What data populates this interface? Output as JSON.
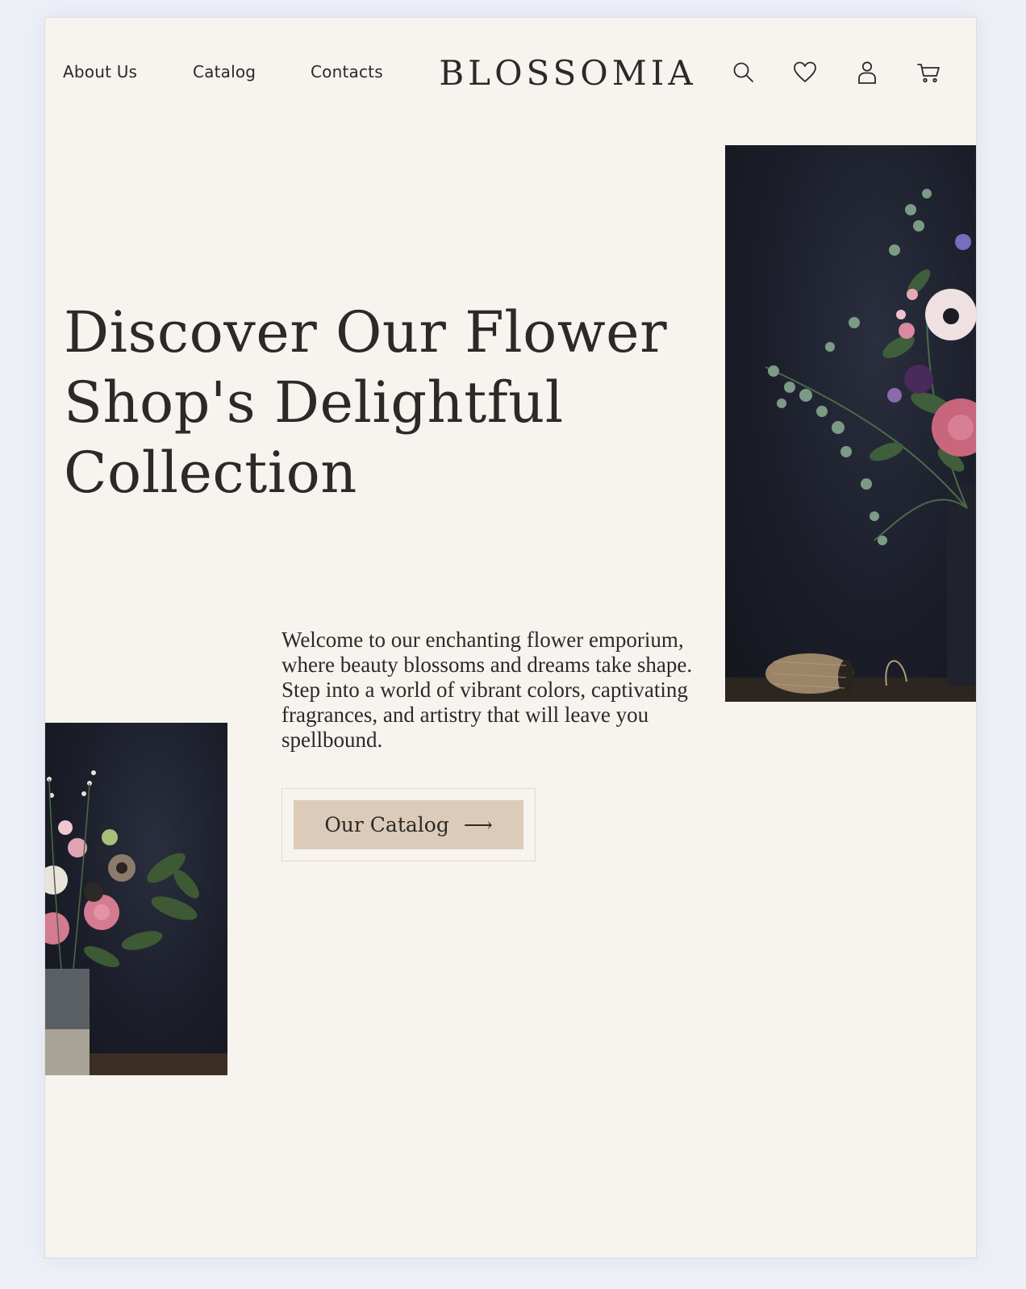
{
  "brand": {
    "logo": "BLOSSOMIA"
  },
  "nav": {
    "links": [
      {
        "label": "About Us"
      },
      {
        "label": "Catalog"
      },
      {
        "label": "Contacts"
      }
    ]
  },
  "header_icons": [
    "search-icon",
    "heart-icon",
    "user-icon",
    "cart-icon"
  ],
  "hero": {
    "headline_lines": [
      "Discover Our Flower",
      "Shop's Delightful",
      "Collection"
    ],
    "intro": "Welcome to our enchanting flower emporium, where beauty blossoms and dreams take shape. Step into a world of vibrant colors, captivating fragrances, and artistry that will leave you spellbound.",
    "cta_label": "Our Catalog",
    "cta_arrow": "⟶"
  },
  "colors": {
    "page_background": "#edf0f7",
    "frame_background": "#f7f3ee",
    "text": "#2b2a28",
    "cta_background": "#dccbb9",
    "cta_border": "#e4d8cb",
    "photo_background": "#1b1e29"
  }
}
